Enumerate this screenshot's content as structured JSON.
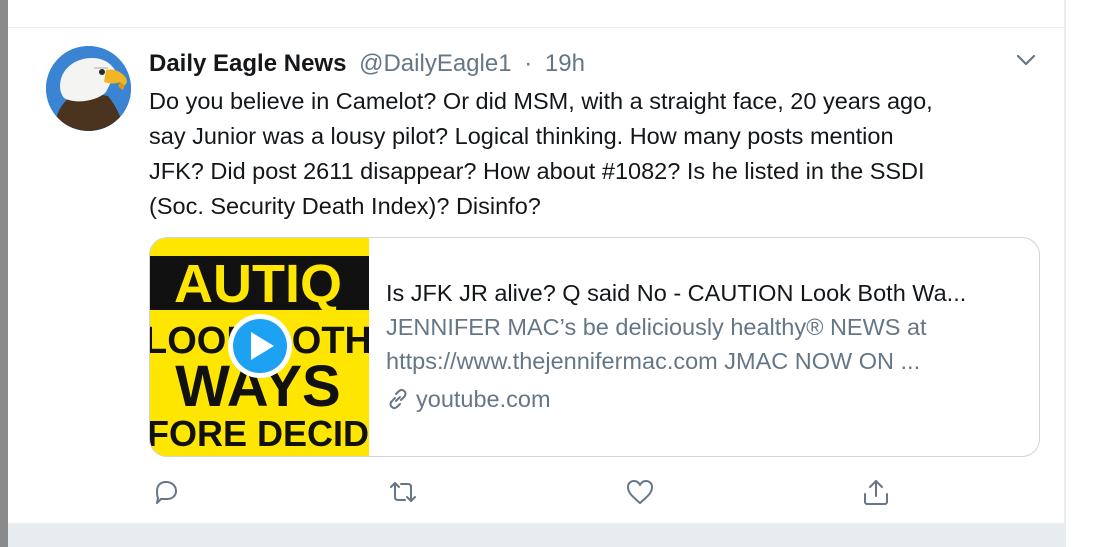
{
  "tweet": {
    "display_name": "Daily Eagle News",
    "handle": "@DailyEagle1",
    "separator": "·",
    "time": "19h",
    "text_lines": [
      "Do you believe in Camelot? Or did MSM, with a straight face, 20 years ago,",
      "say Junior was a lousy pilot? Logical thinking. How many posts mention",
      "JFK? Did post 2611 disappear? How about #1082? Is he listed in the SSDI",
      "(Soc. Security Death Index)? Disinfo?"
    ]
  },
  "card": {
    "thumbnail_lines": [
      "AUTIQ",
      "LOOK BOTH",
      "WAYS",
      "FORE DECID"
    ],
    "title": "Is JFK JR alive? Q said No - CAUTION Look Both Wa...",
    "description_lines": [
      "JENNIFER MAC’s be deliciously healthy® NEWS at",
      "https://www.thejennifermac.com JMAC NOW ON ..."
    ],
    "domain": "youtube.com"
  },
  "colors": {
    "text": "#14171a",
    "secondary": "#657786",
    "border": "#ccd6dd",
    "play_button": "#1da1f2",
    "thumbnail_bg": "#ffe600"
  },
  "icons": {
    "caret": "chevron-down-icon",
    "play": "play-icon",
    "link": "link-icon",
    "reply": "reply-icon",
    "retweet": "retweet-icon",
    "like": "heart-icon",
    "share": "share-icon"
  }
}
